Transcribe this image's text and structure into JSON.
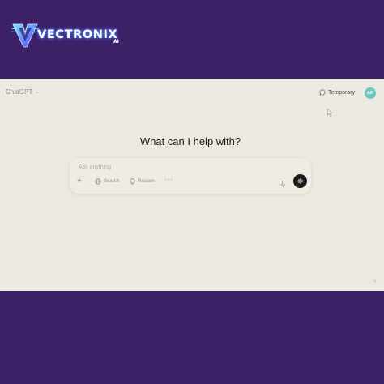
{
  "brand": {
    "name": "VECTRONIX",
    "suffix": "AI",
    "icon": "v-shield-logo",
    "glow_color": "#3ab0ff"
  },
  "app": {
    "model_label": "ChatGPT",
    "temporary_label": "Temporary",
    "avatar_initials": "AK",
    "avatar_color": "#6fc8be",
    "headline": "What can I help with?"
  },
  "composer": {
    "placeholder": "Ask anything",
    "value": "",
    "plus_icon": "plus-icon",
    "search_label": "Search",
    "reason_label": "Reason",
    "more_label": "···",
    "mic_icon": "microphone-icon",
    "voice_icon": "voice-mode-icon"
  },
  "footer": {
    "help_mark": "?"
  },
  "colors": {
    "background": "#3c2167",
    "app_surface": "#eceae0",
    "voice_button": "#1a1a1a"
  }
}
